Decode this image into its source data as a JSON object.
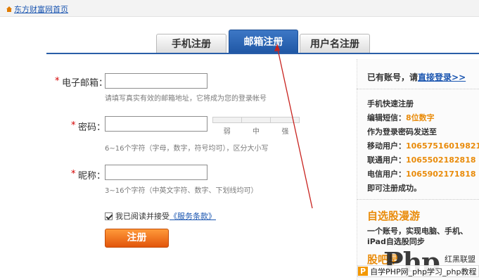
{
  "topbar": {
    "home_link": "东方财富网首页"
  },
  "tabs": [
    {
      "label": "手机注册",
      "active": false
    },
    {
      "label": "邮箱注册",
      "active": true
    },
    {
      "label": "用户名注册",
      "active": false
    }
  ],
  "form": {
    "email": {
      "required_mark": "*",
      "label": "电子邮箱：",
      "value": "",
      "hint": "请填写真实有效的邮箱地址，它将成为您的登录帐号"
    },
    "password": {
      "required_mark": "*",
      "label": "密码：",
      "value": "",
      "hint": "6~16个字符（字母，数字，符号均可），区分大小写",
      "strength_labels": [
        "弱",
        "中",
        "强"
      ]
    },
    "nickname": {
      "required_mark": "*",
      "label": "昵称：",
      "value": "",
      "hint": "3~16个字符（中英文字符、数字、下划线均可）"
    },
    "agree": {
      "checked": true,
      "text": "我已阅读并接受",
      "terms_link": "《服务条款》"
    },
    "submit_label": "注册"
  },
  "sidebar": {
    "login_prompt": "已有账号，请",
    "login_link": "直接登录>>",
    "sms_title": "手机快速注册",
    "sms_edit_prefix": "编辑短信：",
    "sms_edit_value": "8位数字",
    "sms_line3": "作为登录密码发送至",
    "mobile_label": "移动用户：",
    "mobile_number": "10657516019821",
    "unicom_label": "联通用户：",
    "unicom_number": "1065502182818",
    "telecom_label": "电信用户：",
    "telecom_number": "1065902171818",
    "sms_done": "即可注册成功。",
    "promo_title": "自选股漫游",
    "promo_line1": "一个账号，实现电脑、手机、",
    "promo_line2": "iPad自选股同步",
    "promo_title2": "股吧早"
  },
  "watermark": {
    "logo": "Php",
    "small_text": "红黑联盟",
    "bar_prefix": "P",
    "bar_text": "自学PHP网_php学习_php教程"
  },
  "colors": {
    "accent_blue": "#2a5ea8",
    "orange": "#e98b0a",
    "button_orange": "#e2550b",
    "required_red": "#d40000"
  }
}
